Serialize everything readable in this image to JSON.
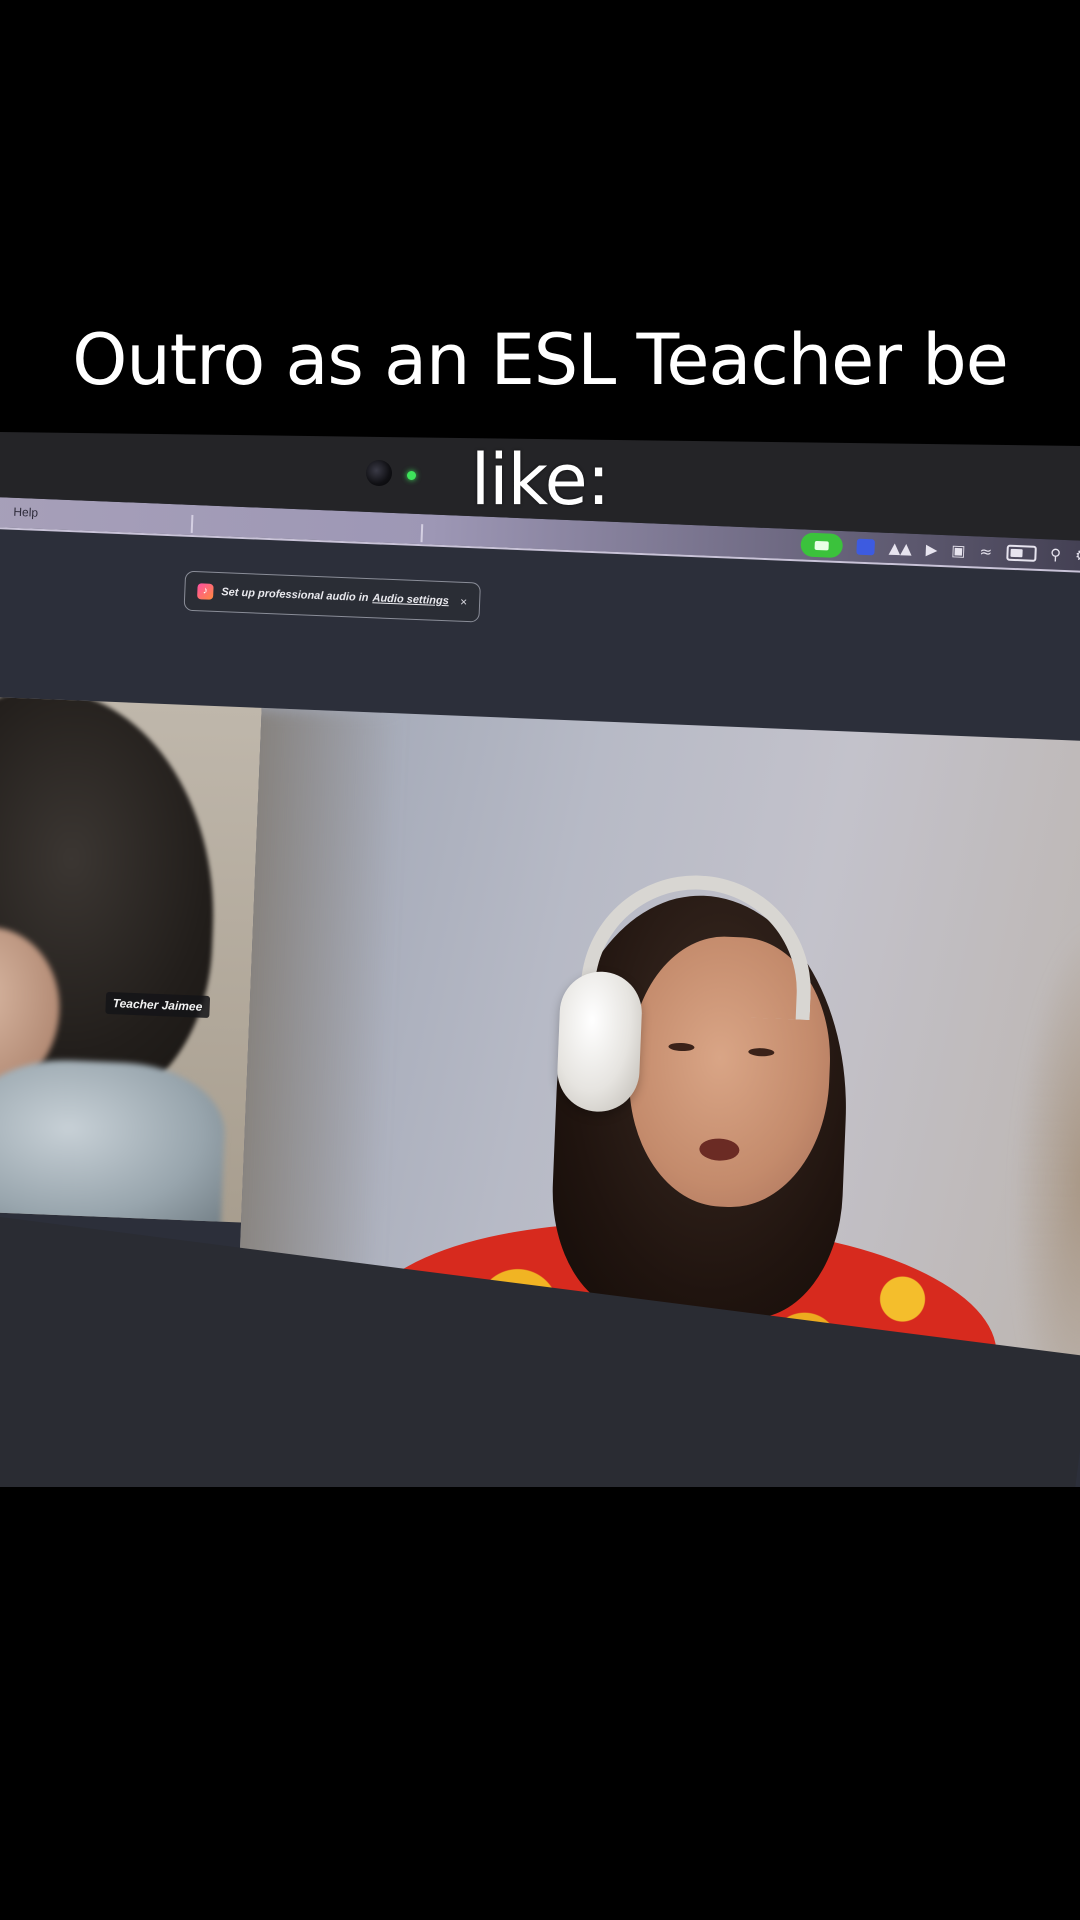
{
  "caption": {
    "line1": "Outro as an ESL Teacher be",
    "line2": "like:"
  },
  "menubar": {
    "help_label": "Help",
    "icons": [
      "zoom-video-icon",
      "meet-icon",
      "bird-icon",
      "play-circle-icon",
      "display-icon",
      "wifi-icon",
      "battery-icon",
      "search-icon",
      "control-center-icon"
    ]
  },
  "notification": {
    "text": "Set up professional audio in",
    "link": "Audio settings",
    "close": "×"
  },
  "participants": {
    "left_label": "Teacher Jaimee"
  },
  "colors": {
    "zoom_green": "#3bc23c",
    "webcam_led": "#3ee45b"
  }
}
